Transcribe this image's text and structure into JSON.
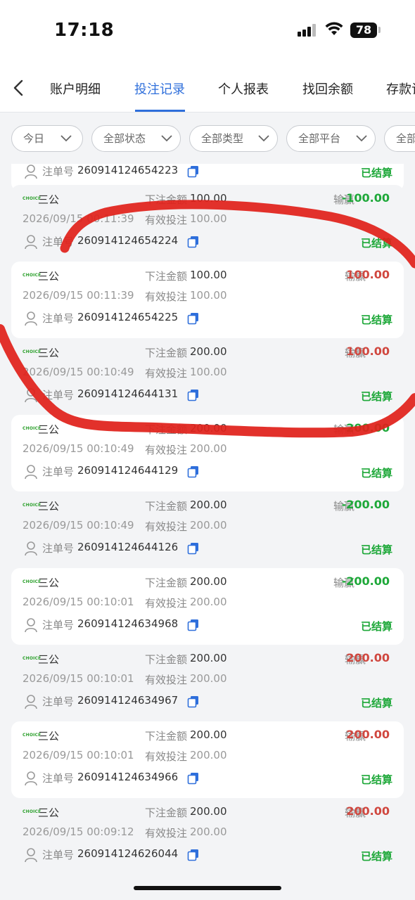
{
  "status_bar": {
    "time": "17:18",
    "battery": "78"
  },
  "nav": {
    "tabs": [
      {
        "label": "账户明细",
        "active": false
      },
      {
        "label": "投注记录",
        "active": true
      },
      {
        "label": "个人报表",
        "active": false
      },
      {
        "label": "找回余额",
        "active": false
      },
      {
        "label": "存款记",
        "active": false
      }
    ]
  },
  "filters": [
    {
      "label": "今日"
    },
    {
      "label": "全部状态"
    },
    {
      "label": "全部类型"
    },
    {
      "label": "全部平台"
    },
    {
      "label": "全部"
    }
  ],
  "labels": {
    "bet_amount": "下注金额",
    "valid_bet": "有效投注",
    "win_loss": "输赢",
    "order_no": "注单号",
    "logo_text": "CHOICE"
  },
  "partial_top_record": {
    "order_no": "260914124654223",
    "status": "已结算"
  },
  "records": [
    {
      "game": "三公",
      "bet_amount": "100.00",
      "win_loss": "-100.00",
      "result": "lose",
      "time": "2026/09/15 00:11:39",
      "valid_bet": "100.00",
      "order_no": "260914124654224",
      "status": "已结算"
    },
    {
      "game": "三公",
      "bet_amount": "100.00",
      "win_loss": "100.00",
      "result": "win",
      "time": "2026/09/15 00:11:39",
      "valid_bet": "100.00",
      "order_no": "260914124654225",
      "status": "已结算"
    },
    {
      "game": "三公",
      "bet_amount": "200.00",
      "win_loss": "100.00",
      "result": "win",
      "time": "2026/09/15 00:10:49",
      "valid_bet": "100.00",
      "order_no": "260914124644131",
      "status": "已结算"
    },
    {
      "game": "三公",
      "bet_amount": "200.00",
      "win_loss": "-200.00",
      "result": "lose",
      "time": "2026/09/15 00:10:49",
      "valid_bet": "200.00",
      "order_no": "260914124644129",
      "status": "已结算"
    },
    {
      "game": "三公",
      "bet_amount": "200.00",
      "win_loss": "-200.00",
      "result": "lose",
      "time": "2026/09/15 00:10:49",
      "valid_bet": "200.00",
      "order_no": "260914124644126",
      "status": "已结算"
    },
    {
      "game": "三公",
      "bet_amount": "200.00",
      "win_loss": "-200.00",
      "result": "lose",
      "time": "2026/09/15 00:10:01",
      "valid_bet": "200.00",
      "order_no": "260914124634968",
      "status": "已结算"
    },
    {
      "game": "三公",
      "bet_amount": "200.00",
      "win_loss": "200.00",
      "result": "win",
      "time": "2026/09/15 00:10:01",
      "valid_bet": "200.00",
      "order_no": "260914124634967",
      "status": "已结算"
    },
    {
      "game": "三公",
      "bet_amount": "200.00",
      "win_loss": "200.00",
      "result": "win",
      "time": "2026/09/15 00:10:01",
      "valid_bet": "200.00",
      "order_no": "260914124634966",
      "status": "已结算"
    },
    {
      "game": "三公",
      "bet_amount": "200.00",
      "win_loss": "200.00",
      "result": "win",
      "time": "2026/09/15 00:09:12",
      "valid_bet": "200.00",
      "order_no": "260914124626044",
      "status": "已结算"
    }
  ],
  "colors": {
    "accent": "#2f6fdb",
    "win": "#d0473f",
    "lose": "#1ea839",
    "annotation": "#e0211b"
  }
}
